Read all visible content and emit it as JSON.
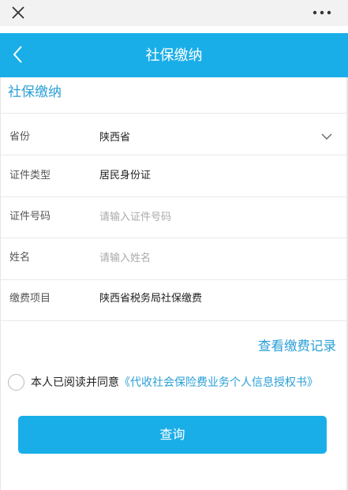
{
  "header": {
    "title": "社保缴纳"
  },
  "section_title": "社保缴纳",
  "form": {
    "province": {
      "label": "省份",
      "value": "陕西省"
    },
    "id_type": {
      "label": "证件类型",
      "value": "居民身份证"
    },
    "id_number": {
      "label": "证件号码",
      "placeholder": "请输入证件号码",
      "value": ""
    },
    "name": {
      "label": "姓名",
      "placeholder": "请输入姓名",
      "value": ""
    },
    "payment_item": {
      "label": "缴费项目",
      "value": "陕西省税务局社保缴费"
    }
  },
  "record_link": "查看缴费记录",
  "agreement": {
    "prefix": "本人已阅读并同意",
    "link": "《代收社会保险费业务个人信息授权书》"
  },
  "query_button": "查询",
  "colors": {
    "accent": "#1aaee8",
    "link": "#2a9fd6"
  }
}
